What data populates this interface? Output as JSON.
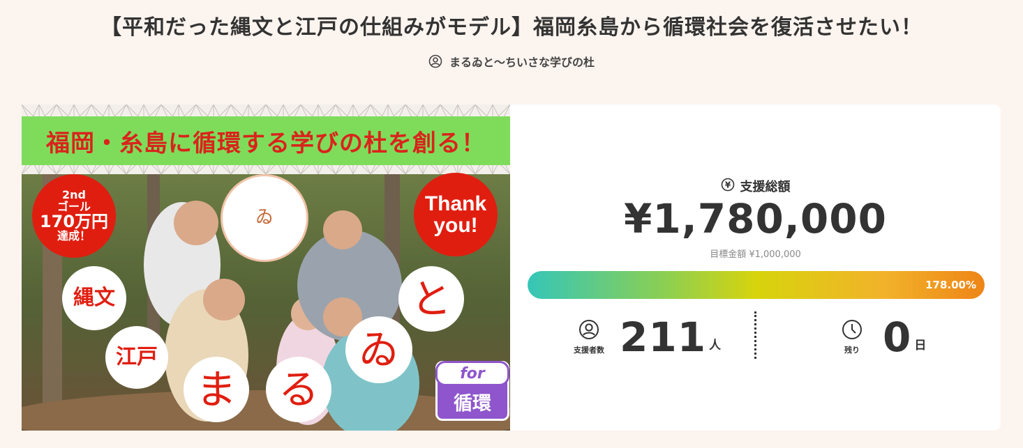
{
  "page": {
    "title": "【平和だった縄文と江戸の仕組みがモデル】福岡糸島から循環社会を復活させたい！",
    "owner_name": "まるゐと〜ちいさな学びの杜"
  },
  "hero_image": {
    "banner_text": "福岡・糸島に循環する学びの杜を創る！",
    "goal_badge": [
      "2nd",
      "ゴール",
      "170万円",
      "達成！"
    ],
    "thanks_badge": [
      "Thank",
      "you!"
    ],
    "circle_jomon": "縄文",
    "circle_edo": "江戸",
    "logo_char": "ゐ",
    "char_ma": "ま",
    "char_ru": "る",
    "char_wi": "ゐ",
    "char_to": "と",
    "for_label": "for",
    "for_value": "循環"
  },
  "funding": {
    "total_label": "支援総額",
    "total_amount": "¥1,780,000",
    "goal_text": "目標金額 ¥1,000,000",
    "progress_percent_text": "178.00%",
    "progress_fraction": 1.0,
    "supporters_label": "支援者数",
    "supporters_count": "211",
    "supporters_unit": "人",
    "remaining_label": "残り",
    "remaining_count": "0",
    "remaining_unit": "日"
  },
  "colors": {
    "background": "#fcf4ef",
    "banner_green": "#7fdc5a",
    "accent_red": "#e01e10",
    "purple": "#8e55cc"
  },
  "icons": {
    "owner": "user-circle-icon",
    "yen": "yen-circle-icon",
    "supporters": "user-circle-icon",
    "remaining": "clock-icon"
  }
}
